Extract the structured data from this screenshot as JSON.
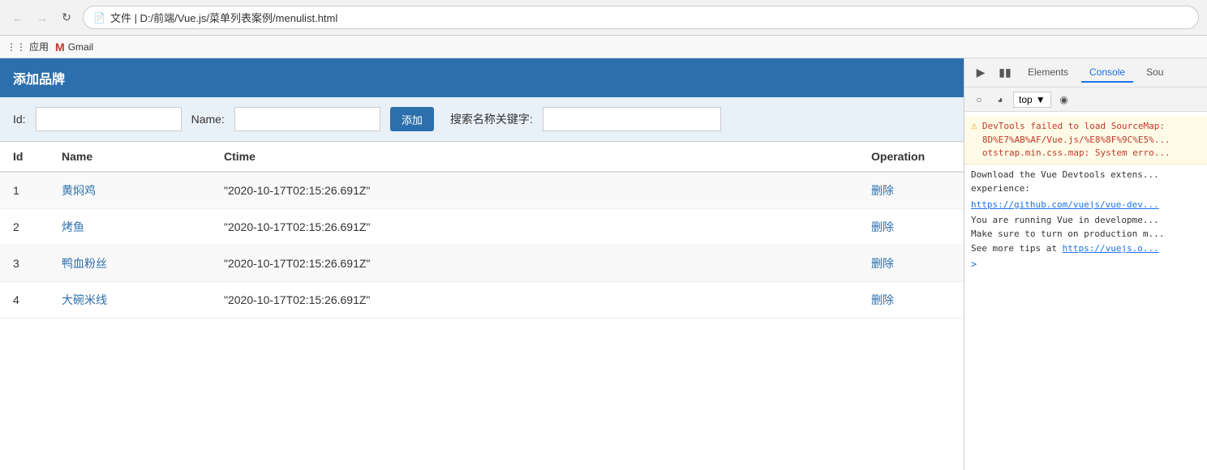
{
  "browser": {
    "url": "文件 | D:/前端/Vue.js/菜单列表案例/menulist.html",
    "bookmarks": [
      {
        "label": "应用",
        "type": "apps"
      },
      {
        "label": "Gmail",
        "type": "gmail"
      }
    ]
  },
  "page": {
    "title": "添加品牌",
    "form": {
      "id_label": "Id:",
      "id_placeholder": "",
      "name_label": "Name:",
      "name_placeholder": "",
      "add_button": "添加",
      "search_label": "搜索名称关键字:",
      "search_placeholder": ""
    },
    "table": {
      "headers": [
        "Id",
        "Name",
        "Ctime",
        "Operation"
      ],
      "rows": [
        {
          "id": "1",
          "name": "黄焖鸡",
          "ctime": "\"2020-10-17T02:15:26.691Z\"",
          "op": "删除"
        },
        {
          "id": "2",
          "name": "烤鱼",
          "ctime": "\"2020-10-17T02:15:26.691Z\"",
          "op": "删除"
        },
        {
          "id": "3",
          "name": "鸭血粉丝",
          "ctime": "\"2020-10-17T02:15:26.691Z\"",
          "op": "删除"
        },
        {
          "id": "4",
          "name": "大碗米线",
          "ctime": "\"2020-10-17T02:15:26.691Z\"",
          "op": "删除"
        }
      ]
    }
  },
  "devtools": {
    "tabs": [
      "Elements",
      "Console",
      "Sou"
    ],
    "active_tab": "Console",
    "toolbar": {
      "context": "top"
    },
    "console_messages": [
      {
        "type": "warn",
        "text": "DevTools failed to load SourceMap: 8D%E7%AB%AF/Vue.js/%E8%8F%9C%E5%... otstrap.min.css.map: System erro..."
      },
      {
        "type": "normal",
        "text": "Download the Vue Devtools extens... experience:"
      },
      {
        "type": "link",
        "text": "https://github.com/vuejs/vue-dev..."
      },
      {
        "type": "normal",
        "text": "You are running Vue in developme... Make sure to turn on production m... See more tips at https://vuejs.o..."
      }
    ]
  }
}
